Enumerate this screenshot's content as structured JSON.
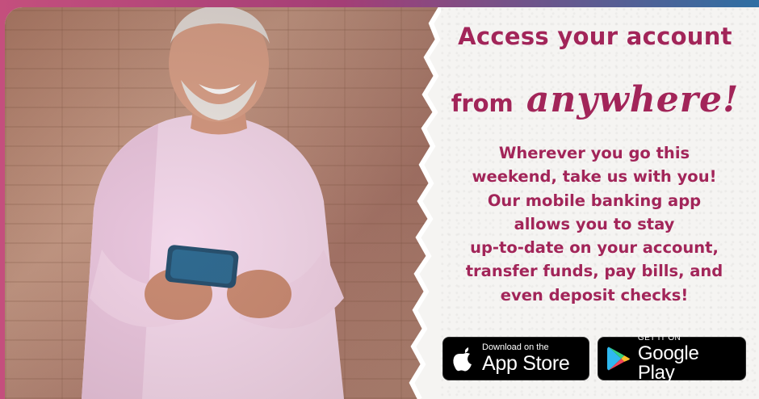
{
  "headline": {
    "line1": "Access your account",
    "line2_prefix": "from",
    "line2_script": "anywhere!"
  },
  "body_lines": [
    "Wherever you go this",
    "weekend, take us with you!",
    "Our mobile banking app",
    "allows you to stay",
    "up-to-date on your account,",
    "transfer funds, pay bills, and",
    "even deposit checks!"
  ],
  "badges": {
    "app_store": {
      "small": "Download on the",
      "big": "App Store",
      "icon": "apple-icon"
    },
    "google_play": {
      "small": "GET IT ON",
      "big": "Google Play",
      "icon": "google-play-icon"
    }
  },
  "photo": {
    "icon": "person-with-phone-photo"
  },
  "colors": {
    "accent": "#a22559",
    "gradient_left": "#c44f7d",
    "gradient_right": "#2f6fa3",
    "badge_bg": "#000000"
  }
}
